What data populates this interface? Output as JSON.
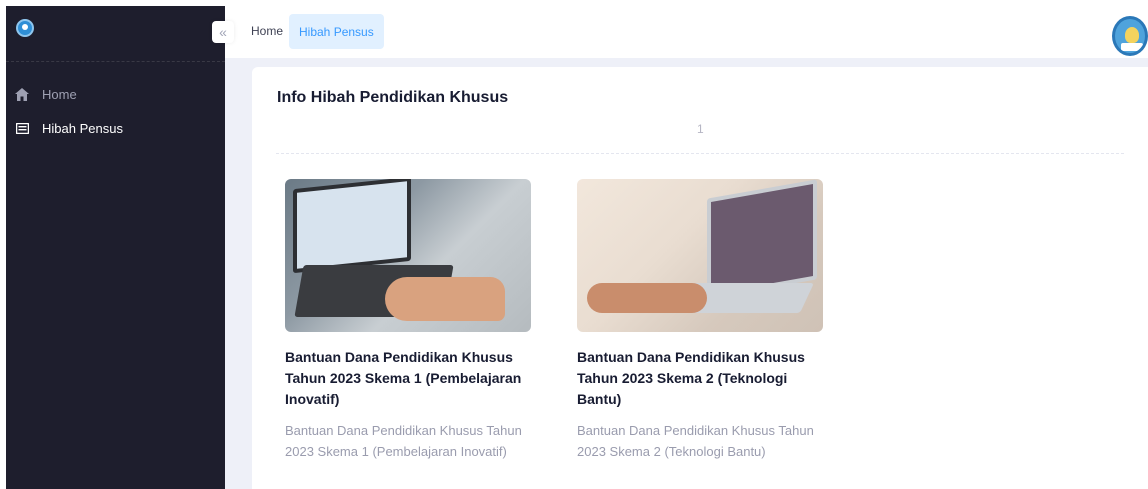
{
  "sidebar": {
    "logo": "kemdikbud-logo",
    "items": [
      {
        "label": "Home",
        "icon": "home-icon",
        "active": false
      },
      {
        "label": "Hibah Pensus",
        "icon": "document-icon",
        "active": true
      }
    ]
  },
  "header": {
    "collapse_icon": "double-chevron-left-icon",
    "breadcrumb_home": "Home",
    "breadcrumb_current": "Hibah Pensus",
    "logo": "tut-wuri-handayani-logo"
  },
  "main": {
    "title": "Info Hibah Pendidikan Khusus",
    "page_number": "1",
    "cards": [
      {
        "title": "Bantuan Dana Pendidikan Khusus Tahun 2023 Skema 1 (Pembelajaran Inovatif)",
        "description": "Bantuan Dana Pendidikan Khusus Tahun 2023 Skema 1 (Pembelajaran Inovatif)"
      },
      {
        "title": "Bantuan Dana Pendidikan Khusus Tahun 2023 Skema 2 (Teknologi Bantu)",
        "description": "Bantuan Dana Pendidikan Khusus Tahun 2023 Skema 2 (Teknologi Bantu)"
      }
    ]
  },
  "colors": {
    "sidebar_bg": "#1e1e2d",
    "accent": "#3699ff",
    "accent_light": "#e1f0ff"
  }
}
